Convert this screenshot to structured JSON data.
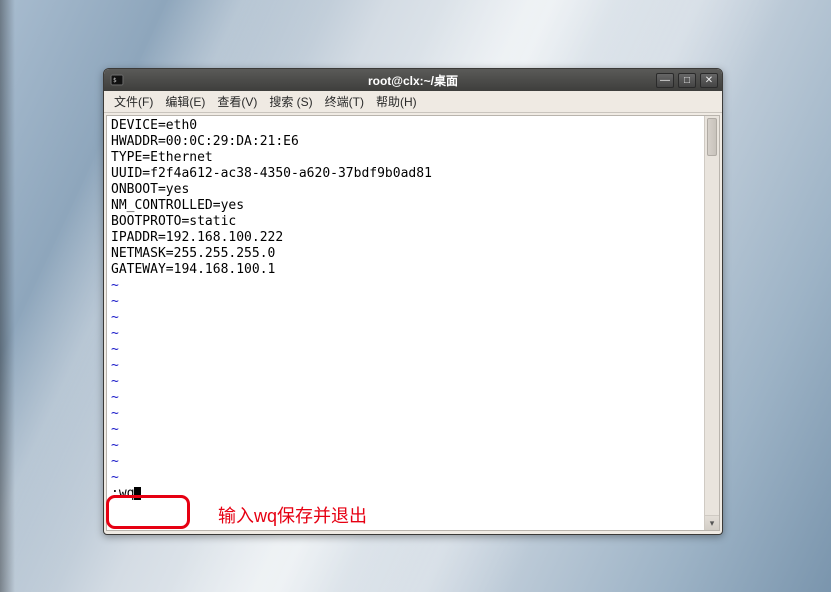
{
  "window": {
    "title": "root@clx:~/桌面"
  },
  "menubar": {
    "items": [
      "文件(F)",
      "编辑(E)",
      "查看(V)",
      "搜索 (S)",
      "终端(T)",
      "帮助(H)"
    ]
  },
  "terminal": {
    "lines": [
      "DEVICE=eth0",
      "HWADDR=00:0C:29:DA:21:E6",
      "TYPE=Ethernet",
      "UUID=f2f4a612-ac38-4350-a620-37bdf9b0ad81",
      "ONBOOT=yes",
      "NM_CONTROLLED=yes",
      "BOOTPROTO=static",
      "IPADDR=192.168.100.222",
      "NETMASK=255.255.255.0",
      "GATEWAY=194.168.100.1"
    ],
    "tilde": "~",
    "command_prefix": ":",
    "command_text": "wq"
  },
  "annotation": {
    "text": "输入wq保存并退出"
  }
}
